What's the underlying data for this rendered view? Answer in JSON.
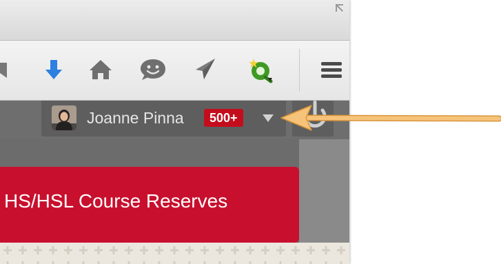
{
  "user": {
    "name": "Joanne Pinna",
    "notification_count": "500+"
  },
  "banner": {
    "label": "HS/HSL Course Reserves"
  },
  "toolbar": {
    "icons": [
      "bookmark-icon",
      "download-arrow-icon",
      "home-icon",
      "chat-icon",
      "send-icon",
      "extension-icon",
      "menu-icon"
    ]
  },
  "colors": {
    "badge": "#c40d1c",
    "banner": "#c8102e",
    "download_arrow": "#2d7fe0",
    "annotation_arrow": "#f6c37a"
  }
}
